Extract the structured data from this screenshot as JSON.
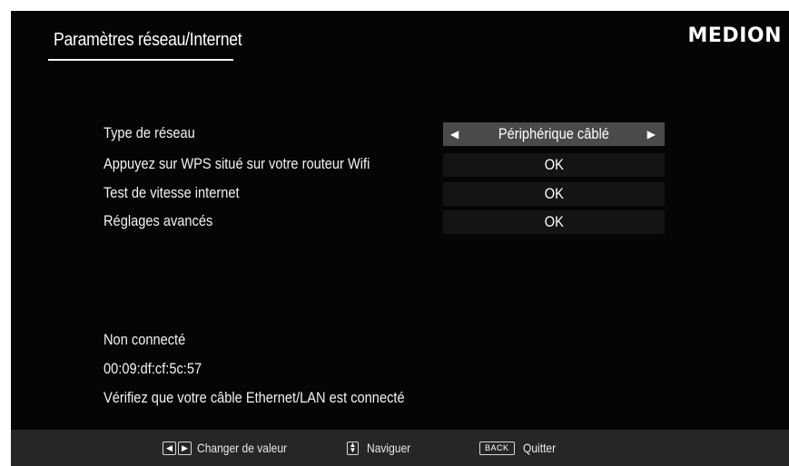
{
  "header": {
    "title": "Paramètres réseau/Internet",
    "brand": "MEDION"
  },
  "settings": {
    "rows": [
      {
        "label": "Type de réseau",
        "value": "Périphérique câblé",
        "selected": true
      },
      {
        "label": "Appuyez sur WPS situé sur votre routeur Wifi",
        "value": "OK"
      },
      {
        "label": "Test de vitesse internet",
        "value": "OK"
      },
      {
        "label": "Réglages avancés",
        "value": "OK"
      }
    ],
    "arrow_left": "◀",
    "arrow_right": "▶"
  },
  "status": {
    "connection": "Non connecté",
    "mac_address": "00:09:df:cf:5c:57",
    "message": "Vérifiez que votre câble Ethernet/LAN est connecté"
  },
  "footer": {
    "change_value_label": "Changer de valeur",
    "navigate_label": "Naviguer",
    "back_key": "BACK",
    "quit_label": "Quitter",
    "key_left": "◀",
    "key_right": "▶",
    "key_up": "▲",
    "key_down": "▼"
  },
  "colors": {
    "background": "#050505",
    "selected_row": "#4a4a4a",
    "value_cell": "#141414",
    "footer": "#262626",
    "text": "#f2f2f2"
  }
}
